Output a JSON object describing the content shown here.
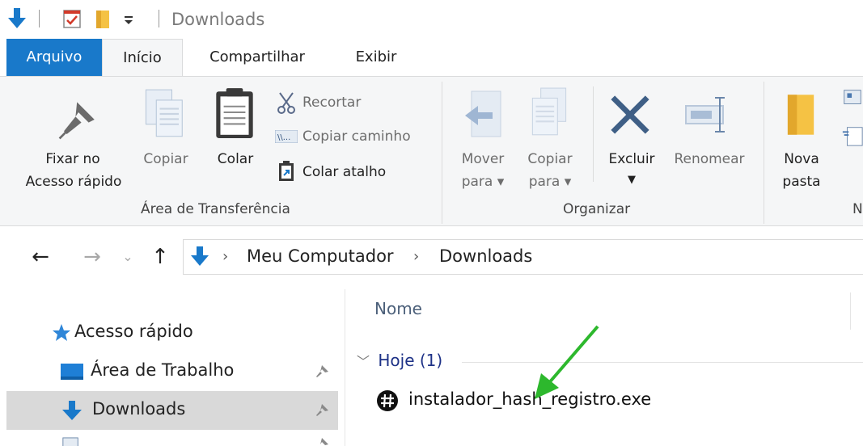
{
  "window": {
    "title": "Downloads"
  },
  "quick_access_toolbar": {
    "icons": [
      "downloads-arrow-icon",
      "properties-check-icon",
      "new-folder-icon",
      "customize-dropdown-icon"
    ]
  },
  "ribbon_tabs": [
    {
      "label": "Arquivo"
    },
    {
      "label": "Início"
    },
    {
      "label": "Compartilhar"
    },
    {
      "label": "Exibir"
    }
  ],
  "ribbon": {
    "clipboard": {
      "pin_line1": "Fixar no",
      "pin_line2": "Acesso rápido",
      "copy": "Copiar",
      "paste": "Colar",
      "cut": "Recortar",
      "copy_path": "Copiar caminho",
      "paste_shortcut": "Colar atalho",
      "group_label": "Área de Transferência"
    },
    "organize": {
      "move_line1": "Mover",
      "move_line2": "para",
      "copyto_line1": "Copiar",
      "copyto_line2": "para",
      "delete": "Excluir",
      "rename": "Renomear",
      "group_label": "Organizar"
    },
    "new": {
      "new_folder_line1": "Nova",
      "new_folder_line2": "pasta",
      "group_label_partial": "N"
    }
  },
  "address": {
    "breadcrumbs": [
      "Meu Computador",
      "Downloads"
    ]
  },
  "nav_pane": {
    "items": [
      {
        "label": "Acesso rápido",
        "icon": "star-icon"
      },
      {
        "label": "Área de Trabalho",
        "icon": "desktop-icon",
        "pinned": true
      },
      {
        "label": "Downloads",
        "icon": "download-arrow-icon",
        "pinned": true,
        "selected": true
      }
    ]
  },
  "content": {
    "column_header": "Nome",
    "group_label": "Hoje (1)",
    "files": [
      {
        "name": "instalador_hash_registro.exe",
        "icon": "hash-exe-icon"
      }
    ]
  },
  "colors": {
    "accent": "#1979ca",
    "annotation_arrow": "#2db82d",
    "selected_row": "#d9d9d9",
    "group_header": "#1e3287"
  }
}
